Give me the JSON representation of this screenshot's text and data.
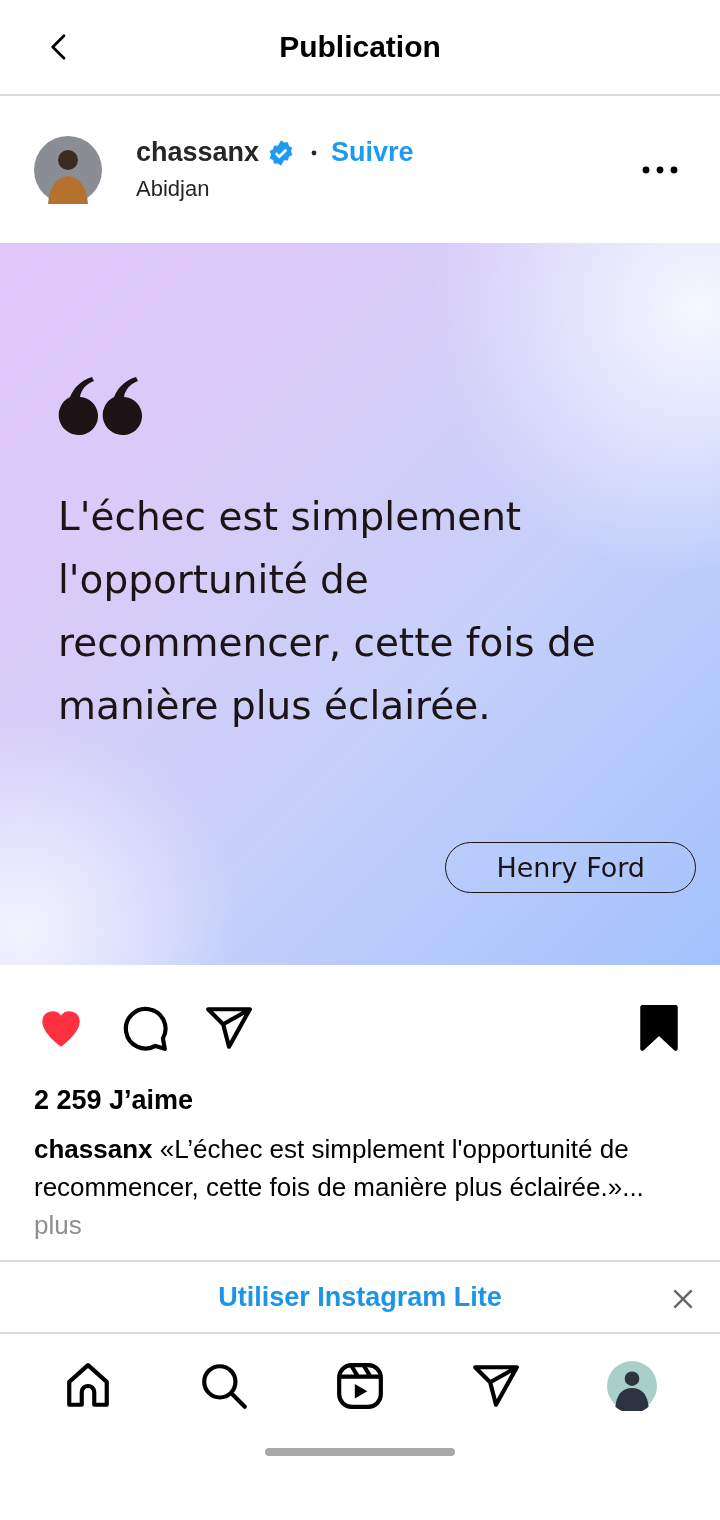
{
  "header": {
    "title": "Publication"
  },
  "post": {
    "username": "chassanx",
    "verified": true,
    "follow": "Suivre",
    "location": "Abidjan",
    "quote": {
      "text": "L'échec est simplement l'opportunité de recommencer, cette fois de manière plus éclairée.",
      "author": "Henry Ford"
    },
    "liked": true,
    "saved": true,
    "likes": "2 259 J’aime",
    "caption": "**chassanx** «L’échec est simplement l'opportunité de recommencer, cette fois de manière plus éclairée.»...",
    "more": "plus"
  },
  "banner": {
    "label": "Utiliser Instagram Lite"
  },
  "nav": [
    {
      "kind": "home"
    },
    {
      "kind": "search"
    },
    {
      "kind": "reels"
    },
    {
      "kind": "direct"
    },
    {
      "kind": "profile"
    }
  ]
}
